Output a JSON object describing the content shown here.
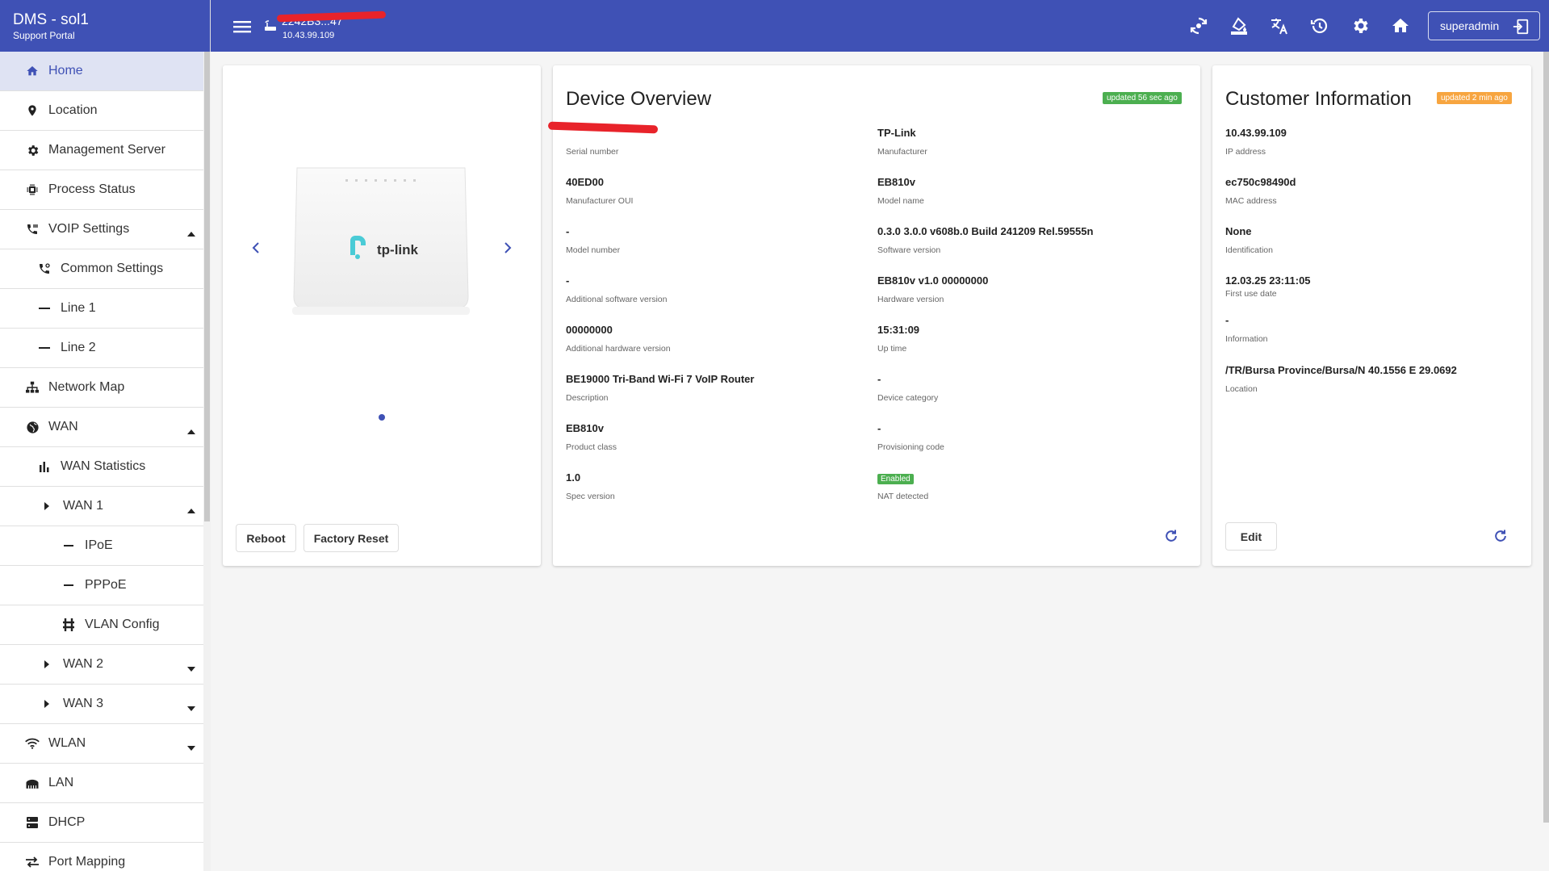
{
  "brand": {
    "title": "DMS - sol1",
    "subtitle": "Support Portal"
  },
  "topbar": {
    "device_id": "2242B3...47",
    "device_ip": "10.43.99.109",
    "icons": [
      "sync-icon",
      "format-paint-icon",
      "translate-icon",
      "history-icon",
      "settings-icon",
      "home-icon"
    ],
    "user": "superadmin"
  },
  "sidebar": {
    "items": [
      {
        "label": "Home",
        "icon": "home-icon"
      },
      {
        "label": "Location",
        "icon": "location-pin-icon"
      },
      {
        "label": "Management Server",
        "icon": "gear-icon"
      },
      {
        "label": "Process Status",
        "icon": "chip-icon"
      },
      {
        "label": "VOIP Settings",
        "icon": "phone-icon"
      },
      {
        "label": "Common Settings",
        "icon": "phone-settings-icon"
      },
      {
        "label": "Line 1",
        "icon": "dash-icon"
      },
      {
        "label": "Line 2",
        "icon": "dash-icon"
      },
      {
        "label": "Network Map",
        "icon": "sitemap-icon"
      },
      {
        "label": "WAN",
        "icon": "globe-icon"
      },
      {
        "label": "WAN Statistics",
        "icon": "bar-chart-icon"
      },
      {
        "label": "WAN 1",
        "icon": "triangle-right-icon"
      },
      {
        "label": "IPoE",
        "icon": "dash-icon"
      },
      {
        "label": "PPPoE",
        "icon": "dash-icon"
      },
      {
        "label": "VLAN Config",
        "icon": "vlan-icon"
      },
      {
        "label": "WAN 2",
        "icon": "triangle-right-icon"
      },
      {
        "label": "WAN 3",
        "icon": "triangle-right-icon"
      },
      {
        "label": "WLAN",
        "icon": "wifi-icon"
      },
      {
        "label": "LAN",
        "icon": "ethernet-icon"
      },
      {
        "label": "DHCP",
        "icon": "server-icon"
      },
      {
        "label": "Port Mapping",
        "icon": "swap-icon"
      }
    ]
  },
  "device_image": {
    "brand_text": "tp-link",
    "buttons": {
      "reboot": "Reboot",
      "factory_reset": "Factory Reset"
    }
  },
  "overview": {
    "title": "Device Overview",
    "badge": "updated 56 sec ago",
    "left": [
      {
        "value": "",
        "label": "Serial number"
      },
      {
        "value": "40ED00",
        "label": "Manufacturer OUI"
      },
      {
        "value": "-",
        "label": "Model number"
      },
      {
        "value": "-",
        "label": "Additional software version"
      },
      {
        "value": "00000000",
        "label": "Additional hardware version"
      },
      {
        "value": "BE19000 Tri-Band Wi-Fi 7 VoIP Router",
        "label": "Description"
      },
      {
        "value": "EB810v",
        "label": "Product class"
      },
      {
        "value": "1.0",
        "label": "Spec version"
      }
    ],
    "right": [
      {
        "value": "TP-Link",
        "label": "Manufacturer"
      },
      {
        "value": "EB810v",
        "label": "Model name"
      },
      {
        "value": "0.3.0 3.0.0 v608b.0 Build 241209 Rel.59555n",
        "label": "Software version"
      },
      {
        "value": "EB810v v1.0 00000000",
        "label": "Hardware version"
      },
      {
        "value": "15:31:09",
        "label": "Up time"
      },
      {
        "value": "-",
        "label": "Device category"
      },
      {
        "value": "-",
        "label": "Provisioning code"
      },
      {
        "value": "Enabled",
        "label": "NAT detected"
      }
    ]
  },
  "customer": {
    "title": "Customer Information",
    "badge": "updated 2 min ago",
    "fields": [
      {
        "value": "10.43.99.109",
        "label": "IP address"
      },
      {
        "value": "ec750c98490d",
        "label": "MAC address"
      },
      {
        "value": "None",
        "label": "Identification"
      },
      {
        "value": "12.03.25 23:11:05",
        "label": "First use date"
      },
      {
        "value": "-",
        "label": "Information"
      },
      {
        "value": "/TR/Bursa Province/Bursa/N 40.1556 E 29.0692",
        "label": "Location"
      }
    ],
    "edit": "Edit"
  },
  "colors": {
    "primary": "#3f51b5",
    "green": "#4caf50",
    "orange": "#f7a540",
    "redaction": "#e8232a",
    "tplink": "#4acbd6"
  }
}
